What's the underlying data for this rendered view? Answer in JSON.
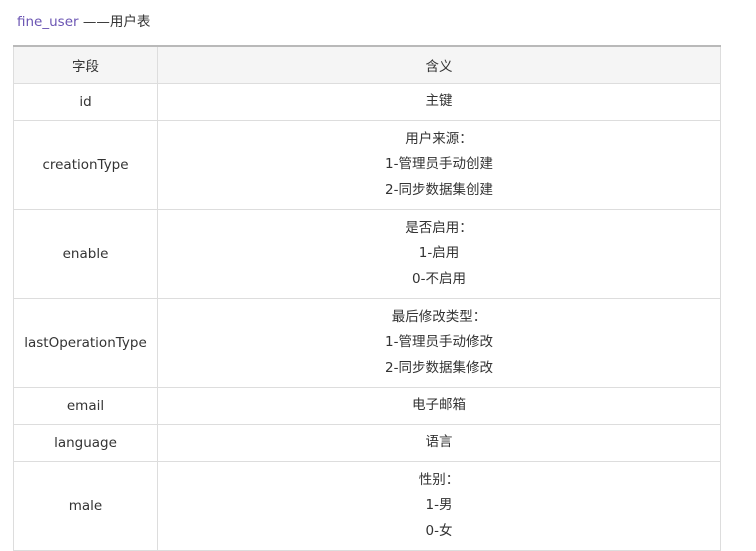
{
  "doc": {
    "table_name": "fine_user",
    "table_desc": " ——用户表"
  },
  "table": {
    "headers": [
      "字段",
      "含义"
    ],
    "rows": [
      {
        "field": "id",
        "meaning": [
          "主键"
        ]
      },
      {
        "field": "creationType",
        "meaning": [
          "用户来源：",
          "1-管理员手动创建",
          "2-同步数据集创建"
        ]
      },
      {
        "field": "enable",
        "meaning": [
          "是否启用：",
          "1-启用",
          "0-不启用"
        ]
      },
      {
        "field": "lastOperationType",
        "meaning": [
          "最后修改类型：",
          "1-管理员手动修改",
          "2-同步数据集修改"
        ]
      },
      {
        "field": "email",
        "meaning": [
          "电子邮箱"
        ]
      },
      {
        "field": "language",
        "meaning": [
          "语言"
        ]
      },
      {
        "field": "male",
        "meaning": [
          "性别：",
          "1-男",
          "0-女"
        ]
      }
    ]
  }
}
